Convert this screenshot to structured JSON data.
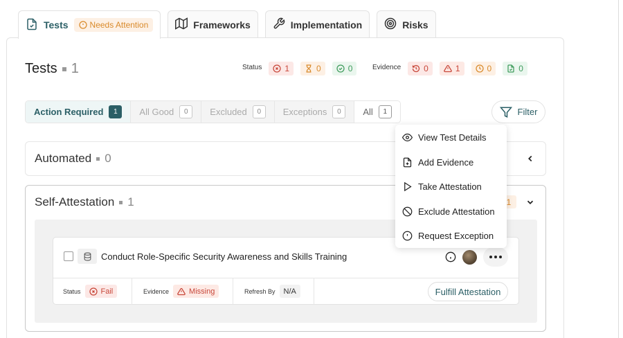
{
  "tabs": [
    {
      "label": "Tests",
      "icon": "file-check-icon",
      "active": true
    },
    {
      "label": "Frameworks",
      "icon": "map-icon"
    },
    {
      "label": "Implementation",
      "icon": "wrench-icon"
    },
    {
      "label": "Risks",
      "icon": "target-icon"
    }
  ],
  "attention_badge": "Needs Attention",
  "header": {
    "title": "Tests",
    "count": "1"
  },
  "status_summary": {
    "label": "Status",
    "fail": "1",
    "pending": "0",
    "passed": "0"
  },
  "evidence_summary": {
    "label": "Evidence",
    "expired": "0",
    "missing": "1",
    "due_soon": "0",
    "ok": "0"
  },
  "segments": [
    {
      "label": "Action Required",
      "count": "1"
    },
    {
      "label": "All Good",
      "count": "0"
    },
    {
      "label": "Excluded",
      "count": "0"
    },
    {
      "label": "Exceptions",
      "count": "0"
    },
    {
      "label": "All",
      "count": "1"
    }
  ],
  "filter_label": "Filter",
  "sections": {
    "automated": {
      "title": "Automated",
      "count": "0"
    },
    "self_attestation": {
      "title": "Self-Attestation",
      "count": "1",
      "badge": "1"
    }
  },
  "test_item": {
    "name": "Conduct Role-Specific Security Awareness and Skills Training",
    "status_label": "Status",
    "status_value": "Fail",
    "evidence_label": "Evidence",
    "evidence_value": "Missing",
    "refresh_label": "Refresh By",
    "refresh_value": "N/A",
    "action_label": "Fulfill Attestation"
  },
  "context_menu": [
    {
      "label": "View Test Details",
      "icon": "eye-icon"
    },
    {
      "label": "Add Evidence",
      "icon": "file-plus-icon"
    },
    {
      "label": "Take Attestation",
      "icon": "play-icon"
    },
    {
      "label": "Exclude Attestation",
      "icon": "ban-icon"
    },
    {
      "label": "Request Exception",
      "icon": "alert-circle-icon"
    }
  ],
  "colors": {
    "accent": "#2b5f66",
    "fail": "#c8473a",
    "warning": "#d98a2b",
    "success": "#3f9b5c"
  }
}
